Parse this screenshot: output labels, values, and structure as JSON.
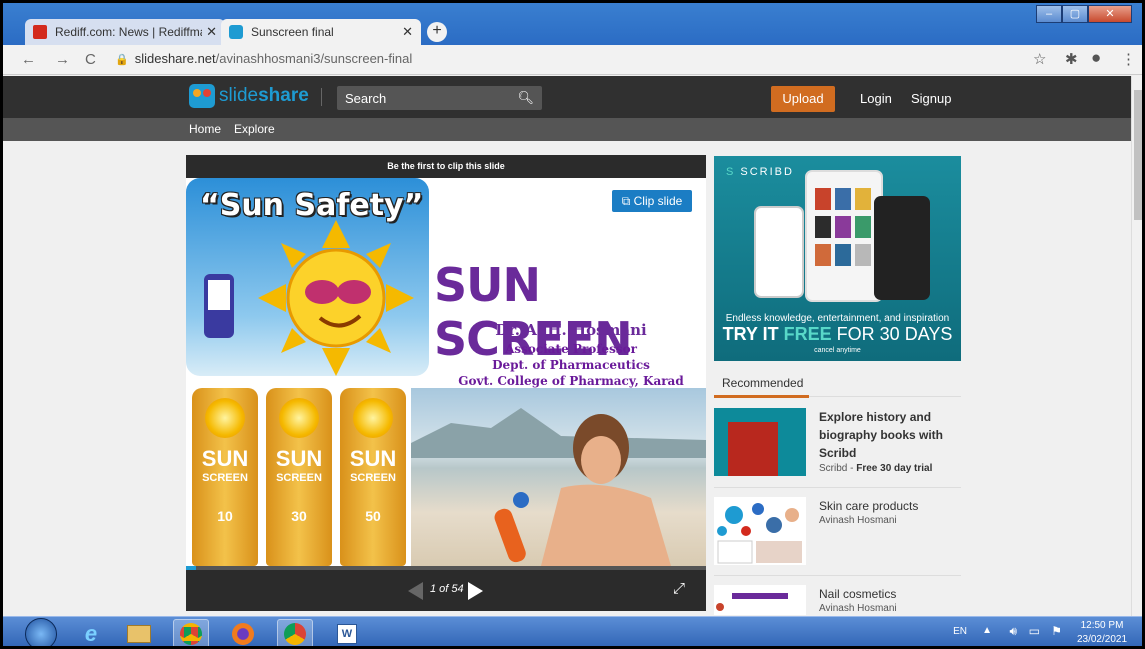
{
  "browser": {
    "tabs": [
      {
        "label": "Rediff.com: News | Rediffmail | St..."
      },
      {
        "label": "Sunscreen final"
      }
    ],
    "new_tab": "+",
    "url_host": "slideshare.net",
    "url_path": "/avinashhosmani3/sunscreen-final"
  },
  "site": {
    "logo_slide": "slide",
    "logo_share": "share",
    "search_placeholder": "Search",
    "upload_label": "Upload",
    "login_label": "Login",
    "signup_label": "Signup",
    "subnav": {
      "home": "Home",
      "explore": "Explore"
    }
  },
  "player": {
    "clip_banner": "Be the first to clip this slide",
    "clip_button": "Clip slide",
    "page_indicator": "1 of 54",
    "progress_fraction": 0.0185
  },
  "slide": {
    "sun_safety": "“Sun Safety”",
    "title": "SUN SCREEN",
    "author": "Dr. A. H. Hosmani",
    "role": "Associate Professor",
    "dept": "Dept. of Pharmaceutics",
    "college": "Govt. College of Pharmacy, Karad",
    "tubes": [
      {
        "line1": "SUN",
        "line2": "SCREEN",
        "spf": "10"
      },
      {
        "line1": "SUN",
        "line2": "SCREEN",
        "spf": "30"
      },
      {
        "line1": "SUN",
        "line2": "SCREEN",
        "spf": "50"
      }
    ]
  },
  "ad": {
    "brand": "SCRIBD",
    "tagline": "Endless knowledge, entertainment, and inspiration",
    "cta_try": "TRY IT",
    "cta_free": "FREE",
    "cta_rest": "FOR 30 DAYS",
    "cancel": "cancel anytime"
  },
  "recommended": {
    "tab_label": "Recommended",
    "items": [
      {
        "title": "Explore history and biography books with Scribd",
        "sub_prefix": "Scribd - ",
        "sub_bold": "Free 30 day trial"
      },
      {
        "title": "Skin care products",
        "sub": "Avinash Hosmani"
      },
      {
        "title": "Nail cosmetics",
        "sub": "Avinash Hosmani"
      }
    ]
  },
  "taskbar": {
    "lang": "EN",
    "time": "12:50 PM",
    "date": "23/02/2021"
  },
  "colors": {
    "slideshare_blue": "#1e9bd2",
    "upload_orange": "#d16c20",
    "slide_purple": "#6a2a9a",
    "scribd_teal": "#1b8d9e"
  }
}
